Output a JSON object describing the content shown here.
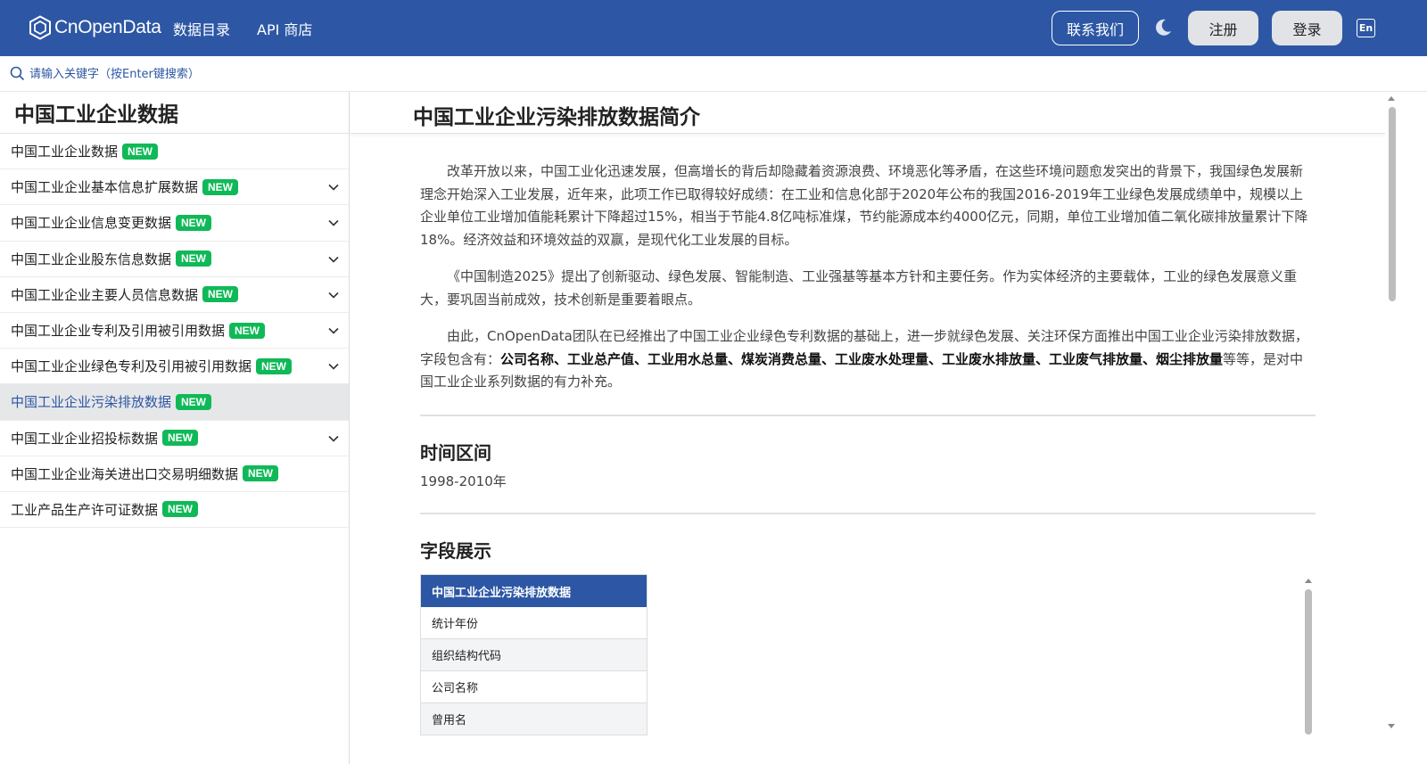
{
  "header": {
    "logo_text": "CnOpenData",
    "nav": [
      "数据目录",
      "API 商店"
    ],
    "contact_label": "联系我们",
    "register_label": "注册",
    "login_label": "登录",
    "lang_label": "En",
    "brand_color": "#2d57a4"
  },
  "search": {
    "placeholder": "请输入关键字（按Enter键搜索）"
  },
  "sidebar": {
    "title": "中国工业企业数据",
    "badge_label": "NEW",
    "items": [
      {
        "label": "中国工业企业数据",
        "expandable": false,
        "active": false
      },
      {
        "label": "中国工业企业基本信息扩展数据",
        "expandable": true,
        "active": false
      },
      {
        "label": "中国工业企业信息变更数据",
        "expandable": true,
        "active": false
      },
      {
        "label": "中国工业企业股东信息数据",
        "expandable": true,
        "active": false
      },
      {
        "label": "中国工业企业主要人员信息数据",
        "expandable": true,
        "active": false
      },
      {
        "label": "中国工业企业专利及引用被引用数据",
        "expandable": true,
        "active": false
      },
      {
        "label": "中国工业企业绿色专利及引用被引用数据",
        "expandable": true,
        "active": false
      },
      {
        "label": "中国工业企业污染排放数据",
        "expandable": false,
        "active": true
      },
      {
        "label": "中国工业企业招投标数据",
        "expandable": true,
        "active": false
      },
      {
        "label": "中国工业企业海关进出口交易明细数据",
        "expandable": false,
        "active": false
      },
      {
        "label": "工业产品生产许可证数据",
        "expandable": false,
        "active": false
      }
    ]
  },
  "main": {
    "title": "中国工业企业污染排放数据简介",
    "para1": "改革开放以来，中国工业化迅速发展，但高增长的背后却隐藏着资源浪费、环境恶化等矛盾，在这些环境问题愈发突出的背景下，我国绿色发展新理念开始深入工业发展，近年来，此项工作已取得较好成绩：在工业和信息化部于2020年公布的我国2016-2019年工业绿色发展成绩单中，规模以上企业单位工业增加值能耗累计下降超过15%，相当于节能4.8亿吨标准煤，节约能源成本约4000亿元，同期，单位工业增加值二氧化碳排放量累计下降18%。经济效益和环境效益的双赢，是现代化工业发展的目标。",
    "para2": "《中国制造2025》提出了创新驱动、绿色发展、智能制造、工业强基等基本方针和主要任务。作为实体经济的主要载体，工业的绿色发展意义重大，要巩固当前成效，技术创新是重要着眼点。",
    "para3_prefix": "由此，CnOpenData团队在已经推出了中国工业企业绿色专利数据的基础上，进一步就绿色发展、关注环保方面推出中国工业企业污染排放数据，字段包含有：",
    "para3_bold": "公司名称、工业总产值、工业用水总量、煤炭消费总量、工业废水处理量、工业废水排放量、工业废气排放量、烟尘排放量",
    "para3_suffix": "等等，是对中国工业企业系列数据的有力补充。",
    "time_title": "时间区间",
    "time_value": "1998-2010年",
    "fields_title": "字段展示",
    "table_header": "中国工业企业污染排放数据",
    "table_rows": [
      "统计年份",
      "组织结构代码",
      "公司名称",
      "曾用名"
    ]
  }
}
